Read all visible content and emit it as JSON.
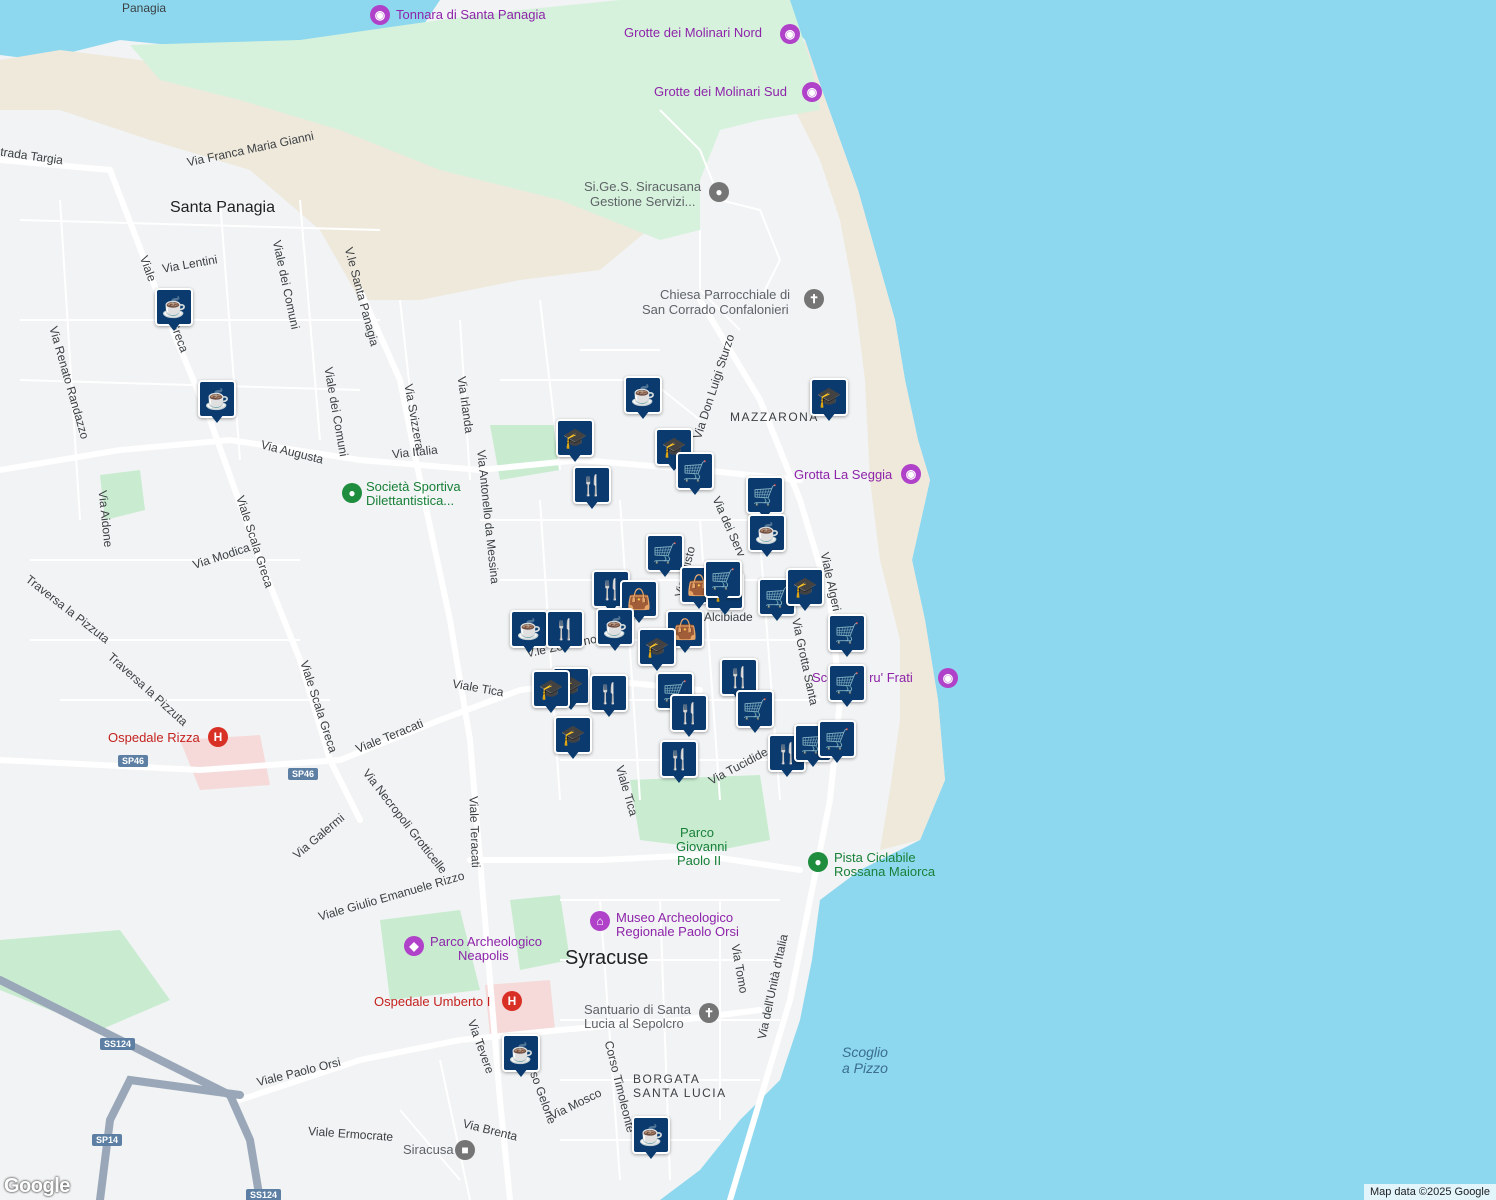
{
  "attribution": "Map data ©2025 Google",
  "logo": "Google",
  "places": {
    "santa_panagia": "Santa Panagia",
    "syracuse": "Syracuse",
    "mazzarona": "MAZZARONA",
    "borgata_1": "BORGATA",
    "borgata_2": "SANTA LUCIA",
    "panagia": "Panagia",
    "scoglio_1": "Scoglio",
    "scoglio_2": "a Pizzo"
  },
  "pois": {
    "tonnara": "Tonnara di Santa Panagia",
    "molinari_nord": "Grotte dei Molinari Nord",
    "molinari_sud": "Grotte dei Molinari Sud",
    "sigess_1": "Si.Ge.S. Siracusana",
    "sigess_2": "Gestione Servizi...",
    "chiesa_1": "Chiesa Parrocchiale di",
    "chiesa_2": "San Corrado Confalonieri",
    "grotta_seggia": "Grotta La Seggia",
    "societa_1": "Società Sportiva",
    "societa_2": "Dilettantistica...",
    "frati": "Scoglio e ru' Frati",
    "parco_gp_1": "Parco",
    "parco_gp_2": "Giovanni",
    "parco_gp_3": "Paolo II",
    "pista_1": "Pista Ciclabile",
    "pista_2": "Rossana Maiorca",
    "museo_1": "Museo Archeologico",
    "museo_2": "Regionale Paolo Orsi",
    "neapolis_1": "Parco Archeologico",
    "neapolis_2": "Neapolis",
    "rizza": "Ospedale Rizza",
    "umberto": "Ospedale Umberto I",
    "santuario_1": "Santuario di Santa",
    "santuario_2": "Lucia al Sepolcro",
    "stazione": "Siracusa"
  },
  "streets": {
    "targia": "trada Targia",
    "franca": "Via Franca Maria Gianni",
    "lentini": "Via Lentini",
    "scala_greca_top": "Viale",
    "scala_greca_top2": "Greca",
    "comuni": "Viale dei Comuni",
    "comuni2": "Viale dei Comuni",
    "santa_panagia": "V.le Santa Panagia",
    "randazzo": "Via Renato Randazzo",
    "svizzera": "Via Svizzera",
    "irlanda": "Via Irlanda",
    "augusta": "Via Augusta",
    "italia": "Via Italia",
    "messina": "Via Antonello da Messina",
    "aidone": "Via Aidone",
    "modica": "Via Modica",
    "scala_greca": "Viale Scala Greca",
    "scala_greca2": "Viale Scala Greca",
    "pizzuta1": "Traversa la Pizzuta",
    "pizzuta2": "Traversa la Pizzuta",
    "tica": "Viale Tica",
    "teracati": "Viale Teracati",
    "teracati2": "Viale Teracati",
    "necropoli": "Via Necropoli Grotticelle",
    "galermi": "Via Galermi",
    "rizzo": "Viale Giulio Emanuele Rizzo",
    "sturzo": "Via Don Luigi Sturzo",
    "algeri": "Viale Algeri",
    "grotta_santa": "Via Grotta Santa",
    "tucidide": "Via Tucidide",
    "tica2": "Viale Tica",
    "alcibiade": "Alcibiade",
    "unita": "Via dell'Unità d'Italia",
    "tomo": "Via Tomo",
    "paolo_orsi": "Viale Paolo Orsi",
    "ermocrate": "Viale Ermocrate",
    "tevere": "Via Tevere",
    "gelone": "Corso Gelone",
    "mosco": "Via Mosco",
    "brenta": "Via Brenta",
    "timoleonte": "Corso Timoleonte",
    "zecchino": "V.le Zecchino",
    "filisto": "Via Filisto",
    "serv": "Via dei Serv"
  },
  "shields": {
    "sp46a": "SP46",
    "sp46b": "SP46",
    "ss124a": "SS124",
    "sp14": "SP14",
    "ss124b": "SS124"
  },
  "markers": [
    {
      "icon": "cafe"
    },
    {
      "icon": "cafe"
    },
    {
      "icon": "cafe"
    },
    {
      "icon": "school"
    },
    {
      "icon": "school"
    },
    {
      "icon": "school"
    },
    {
      "icon": "restaurant"
    },
    {
      "icon": "cart"
    },
    {
      "icon": "cart"
    },
    {
      "icon": "cafe"
    },
    {
      "icon": "school"
    },
    {
      "icon": "cart"
    },
    {
      "icon": "restaurant"
    },
    {
      "icon": "bag"
    },
    {
      "icon": "bag"
    },
    {
      "icon": "school"
    },
    {
      "icon": "cart"
    },
    {
      "icon": "school"
    },
    {
      "icon": "cafe"
    },
    {
      "icon": "restaurant"
    },
    {
      "icon": "cafe"
    },
    {
      "icon": "bag"
    },
    {
      "icon": "school"
    },
    {
      "icon": "cart"
    },
    {
      "icon": "school"
    },
    {
      "icon": "school"
    },
    {
      "icon": "restaurant"
    },
    {
      "icon": "cart"
    },
    {
      "icon": "restaurant"
    },
    {
      "icon": "restaurant"
    },
    {
      "icon": "cart"
    },
    {
      "icon": "cart"
    },
    {
      "icon": "restaurant"
    },
    {
      "icon": "restaurant"
    },
    {
      "icon": "cart"
    },
    {
      "icon": "cart"
    },
    {
      "icon": "cafe"
    },
    {
      "icon": "cafe"
    },
    {
      "icon": "cart"
    }
  ],
  "icons": {
    "cafe": "☕",
    "school": "🎓",
    "restaurant": "🍴",
    "cart": "🛒",
    "bag": "👜"
  }
}
